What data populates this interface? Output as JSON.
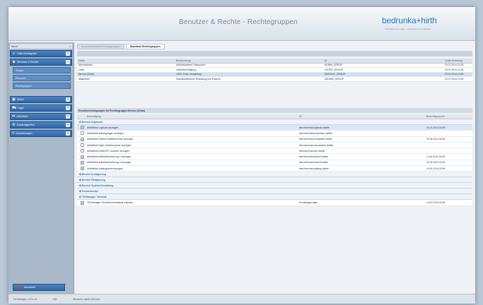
{
  "header": {
    "title": "Benutzer & Rechte  -  Rechtegruppen",
    "logo": "bedrunka+hirth",
    "logo_tagline": "Workplace up to date – mehr Raum zum Arbeiten"
  },
  "sidebar": {
    "top_label": "Menü",
    "items": [
      {
        "label": "Hallo Arbeitsplatz",
        "icon": "user-icon"
      },
      {
        "label": "Benutzer & Rechte",
        "icon": "users-icon"
      }
    ],
    "subitems": [
      "Gruppe",
      "Personen",
      "Rechtegruppen"
    ],
    "items2": [
      {
        "label": "Artikel",
        "icon": "box-icon"
      },
      {
        "label": "Lager",
        "icon": "truck-icon"
      },
      {
        "label": "Aktivitäten",
        "icon": "activity-icon"
      },
      {
        "label": "Zuständigkeiten",
        "icon": "settings-icon"
      },
      {
        "label": "Auswertungen",
        "icon": "search-icon"
      }
    ],
    "logout": "Abmelden"
  },
  "tabs": [
    "Benutzerdefinierte Rechtegruppen",
    "Standard-Rechtegruppen"
  ],
  "groups_table": {
    "headers": [
      "Name",
      "Beschreibung",
      "ID",
      "Letzte Änderung"
    ],
    "rows": [
      [
        "Administrator",
        "Administratives Fullaccount",
        "ADMIN_GROUP",
        "03.07.2014 10:26"
      ],
      [
        "Leiter",
        "Leiterberechtigung",
        "LEITER_GROUP",
        "03.07.2014 10:26"
      ],
      [
        "Service (Entw)",
        "100% Entw. Verwaltung",
        "SERVICE_GROUP",
        "03.07.2014 10:26"
      ],
      [
        "Mitarbeiter",
        "Standardbenutzer Erfassung und Einsicht",
        "MITARB_GROUP",
        "03.07.2014 10:26"
      ]
    ],
    "selected_index": 2
  },
  "permissions": {
    "title": "Einzelberechtigungen für Rechtegruppe Service (Entw)",
    "headers": [
      "Berechtigung",
      "ID",
      "Berechtigung am"
    ],
    "groups": [
      {
        "label": "Bereich Allgemein",
        "rows": [
          {
            "checked": true,
            "name": "Artikelliste Logbuch anzeigen",
            "id": "item.terminal.logbook.visible",
            "date": "14.01.2014 18:09"
          },
          {
            "checked": false,
            "name": "Artikelliste Anfertigungen anzeigen",
            "id": "item.terminal.production.visible",
            "date": ""
          },
          {
            "checked": true,
            "name": "Artikelliste Externe Artikelnummer anzeigen",
            "id": "item.terminal.extnumber.visible",
            "date": "14.01.2014 18:09"
          },
          {
            "checked": false,
            "name": "Artikelliste Eigen Artikelnummer anzeigen",
            "id": "item.terminal.ownnumber.visible",
            "date": ""
          },
          {
            "checked": false,
            "name": "Artikelliste EAN/UPC Nummer anzeigen",
            "id": "item.terminal.ean.visible",
            "date": ""
          },
          {
            "checked": true,
            "name": "Artikelliste Artikelbezeichnung 2 anzeigen",
            "id": "item.terminal.name2.visible",
            "date": "14.01.2014 18:09"
          },
          {
            "checked": true,
            "name": "Artikelliste Artikelbezeichnung 3 anzeigen",
            "id": "item.terminal.name3.visible",
            "date": "14.01.2014 18:09"
          },
          {
            "checked": true,
            "name": "Artikelliste Katalogbezeichnungen",
            "id": "item.terminal.catalog.visible",
            "date": "14.01.2014 18:09"
          }
        ]
      },
      {
        "label": "Bereich Auslagerung",
        "rows": []
      },
      {
        "label": "Bereich Einlagerung",
        "rows": []
      },
      {
        "label": "Bereich System/Verwaltung",
        "rows": []
      },
      {
        "label": "Kundenmodul",
        "rows": []
      },
      {
        "label": "TM Manager Terminal",
        "rows": [
          {
            "checked": true,
            "name": "TM-Manager Terminal Anmeldung zulassen",
            "id": "tm.manager.login",
            "date": "14.07.2014 16:09"
          }
        ]
      }
    ]
  },
  "statusbar": [
    "TM-Manager 1.03 b.41",
    "SQL",
    "Benutzer: admin (Server)"
  ],
  "colors": {
    "accent": "#2f66a8",
    "selected_row": "#cfe0f3",
    "logo": "#1f7cc4"
  }
}
